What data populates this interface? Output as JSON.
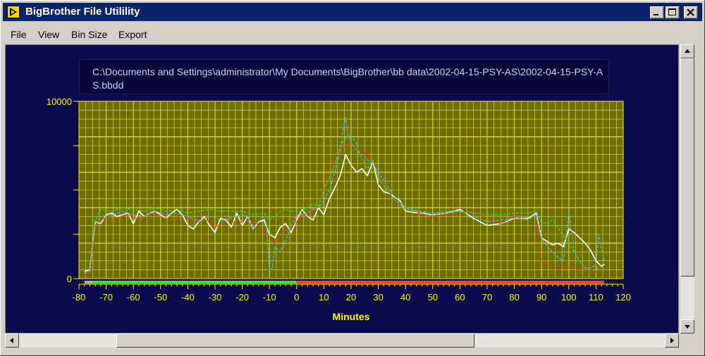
{
  "window": {
    "title": "BigBrother File Utilility"
  },
  "icons": {
    "app": "labview-arrow-icon",
    "minimize": "minimize-icon",
    "maximize": "maximize-icon",
    "close": "close-icon"
  },
  "menu": {
    "items": [
      "File",
      "View",
      "Bin Size",
      "Export"
    ]
  },
  "file_path": "C:\\Documents and Settings\\administrator\\My Documents\\BigBrother\\bb data\\2002-04-15-PSY-AS\\2002-04-15-PSY-AS.bbdd",
  "colors": {
    "plot_bg": "#6e6e00",
    "grid": "#ffff33",
    "axis_text": "#ffff00",
    "window_bg": "#0a0a4c",
    "title_bar": "#0a246a",
    "band_green": "#3ee33e",
    "band_red": "#ff4040",
    "band_gray": "#b0b0b0"
  },
  "chart_data": {
    "type": "line",
    "title": "",
    "xlabel": "Minutes",
    "ylabel": "",
    "xlim": [
      -80,
      120
    ],
    "ylim": [
      0,
      10000
    ],
    "x_ticks": [
      -80,
      -70,
      -60,
      -50,
      -40,
      -30,
      -20,
      -10,
      0,
      10,
      20,
      30,
      40,
      50,
      60,
      70,
      80,
      90,
      100,
      110,
      120
    ],
    "y_tick_labels": [
      "0",
      "10000"
    ],
    "grid": true,
    "bands": [
      {
        "from": -78,
        "to": -75,
        "color": "#b0b0b0"
      },
      {
        "from": -75,
        "to": 0,
        "color": "#3ee33e"
      },
      {
        "from": 0,
        "to": 113,
        "color": "#ff4040"
      }
    ],
    "series": [
      {
        "color": "#ffffff",
        "style": "solid",
        "x": [
          -78,
          -76,
          -74,
          -72,
          -70,
          -68,
          -66,
          -64,
          -62,
          -60,
          -58,
          -56,
          -54,
          -52,
          -50,
          -48,
          -46,
          -44,
          -42,
          -40,
          -38,
          -36,
          -34,
          -32,
          -30,
          -28,
          -26,
          -24,
          -22,
          -20,
          -18,
          -16,
          -14,
          -12,
          -10,
          -8,
          -6,
          -4,
          -2,
          0,
          2,
          4,
          6,
          8,
          10,
          12,
          14,
          16,
          18,
          20,
          22,
          24,
          26,
          28,
          30,
          32,
          34,
          36,
          38,
          40,
          45,
          50,
          55,
          60,
          65,
          70,
          75,
          80,
          85,
          88,
          90,
          92,
          94,
          96,
          98,
          100,
          102,
          104,
          106,
          108,
          110,
          112,
          113
        ],
        "y": [
          400,
          500,
          3200,
          3100,
          3600,
          3700,
          3500,
          3600,
          3700,
          3100,
          3800,
          3500,
          3700,
          3800,
          3600,
          3400,
          3700,
          3900,
          3600,
          3000,
          2800,
          3200,
          3500,
          3000,
          2600,
          3400,
          3300,
          2900,
          3700,
          3000,
          3500,
          2800,
          3200,
          3300,
          2500,
          2300,
          2900,
          3100,
          2600,
          3300,
          3900,
          3500,
          3300,
          4000,
          3600,
          4500,
          5100,
          5800,
          7000,
          6400,
          6000,
          6200,
          5800,
          6600,
          5300,
          4900,
          4800,
          4600,
          4400,
          3800,
          3700,
          3600,
          3700,
          3900,
          3400,
          3000,
          3100,
          3400,
          3400,
          3700,
          2300,
          2100,
          1900,
          2000,
          1800,
          2800,
          2600,
          2300,
          2000,
          1600,
          1000,
          700,
          800
        ]
      },
      {
        "color": "#ff3030",
        "style": "dashed",
        "x": [
          -78,
          -76,
          -74,
          -70,
          -66,
          -62,
          -58,
          -54,
          -50,
          -46,
          -42,
          -38,
          -34,
          -30,
          -26,
          -22,
          -18,
          -14,
          -10,
          -8,
          -6,
          -4,
          -2,
          0,
          2,
          4,
          6,
          8,
          10,
          12,
          14,
          16,
          18,
          20,
          22,
          24,
          26,
          28,
          30,
          35,
          40,
          45,
          50,
          55,
          60,
          65,
          70,
          75,
          80,
          85,
          88,
          90,
          92,
          94,
          96,
          98,
          100,
          102,
          104,
          106,
          108,
          110,
          112
        ],
        "y": [
          200,
          300,
          3000,
          3500,
          3400,
          3600,
          3300,
          3700,
          3500,
          3300,
          3600,
          3200,
          3400,
          2900,
          3300,
          3100,
          3400,
          3000,
          2200,
          2000,
          2400,
          2700,
          2900,
          3200,
          3600,
          3500,
          3800,
          4100,
          5000,
          6200,
          6500,
          7300,
          7500,
          7700,
          7300,
          7200,
          7000,
          6600,
          6000,
          4600,
          4000,
          3700,
          3500,
          3600,
          3700,
          3800,
          3400,
          3100,
          3500,
          3300,
          3600,
          1000,
          800,
          700,
          500,
          700,
          600,
          600,
          400,
          700,
          500,
          400,
          400
        ]
      },
      {
        "color": "#30e030",
        "style": "dashed",
        "x": [
          -78,
          -76,
          -74,
          -72,
          -68,
          -64,
          -60,
          -56,
          -52,
          -48,
          -44,
          -40,
          -36,
          -32,
          -28,
          -24,
          -20,
          -16,
          -12,
          -10,
          -8,
          -6,
          -4,
          -2,
          0,
          2,
          4,
          6,
          8,
          10,
          12,
          14,
          16,
          18,
          20,
          22,
          24,
          26,
          28,
          30,
          35,
          40,
          45,
          50,
          55,
          60,
          65,
          70,
          75,
          80,
          85,
          88,
          90,
          92,
          94,
          96,
          98,
          100,
          102,
          104,
          106,
          108,
          110,
          112
        ],
        "y": [
          300,
          400,
          3300,
          3900,
          3800,
          4000,
          3900,
          3800,
          4000,
          3800,
          3900,
          3700,
          3800,
          3900,
          3800,
          3800,
          3800,
          3600,
          3700,
          3300,
          3500,
          3800,
          3900,
          3800,
          3800,
          3800,
          4000,
          4200,
          4100,
          5000,
          5700,
          6400,
          7500,
          7900,
          8100,
          7600,
          6700,
          6200,
          6700,
          5700,
          4600,
          3900,
          3800,
          3700,
          3800,
          3800,
          3700,
          3600,
          3600,
          3700,
          3700,
          3800,
          3200,
          3100,
          3300,
          2900,
          2400,
          2000,
          1500,
          1000,
          600,
          500,
          500,
          800
        ]
      },
      {
        "color": "#4fb8e8",
        "style": "dashed",
        "x": [
          -78,
          -76,
          -74,
          -72,
          -68,
          -64,
          -60,
          -56,
          -52,
          -48,
          -44,
          -40,
          -36,
          -32,
          -28,
          -24,
          -20,
          -18,
          -16,
          -14,
          -12,
          -11,
          -10,
          -9,
          -8,
          -6,
          -4,
          -2,
          0,
          2,
          4,
          6,
          8,
          10,
          12,
          14,
          16,
          17,
          18,
          19,
          20,
          22,
          24,
          26,
          28,
          30,
          35,
          40,
          45,
          50,
          55,
          60,
          65,
          70,
          75,
          80,
          85,
          88,
          90,
          92,
          94,
          96,
          98,
          100,
          102,
          104,
          106,
          108,
          110,
          111,
          112,
          113
        ],
        "y": [
          300,
          400,
          3100,
          3500,
          3600,
          3800,
          3600,
          3500,
          3800,
          3600,
          3700,
          3500,
          3200,
          3500,
          3300,
          3400,
          3600,
          3500,
          2800,
          3200,
          3500,
          3000,
          300,
          600,
          1800,
          1500,
          2200,
          3000,
          3600,
          3600,
          3700,
          3900,
          4000,
          4400,
          5000,
          6000,
          7200,
          8300,
          9100,
          8000,
          7700,
          7200,
          7000,
          6700,
          6500,
          6000,
          4800,
          4000,
          3800,
          3600,
          3700,
          3800,
          3500,
          3200,
          3300,
          3400,
          3300,
          3600,
          2300,
          1800,
          1500,
          1200,
          1000,
          3800,
          1500,
          1000,
          600,
          600,
          800,
          2500,
          1700,
          1000
        ]
      }
    ]
  }
}
